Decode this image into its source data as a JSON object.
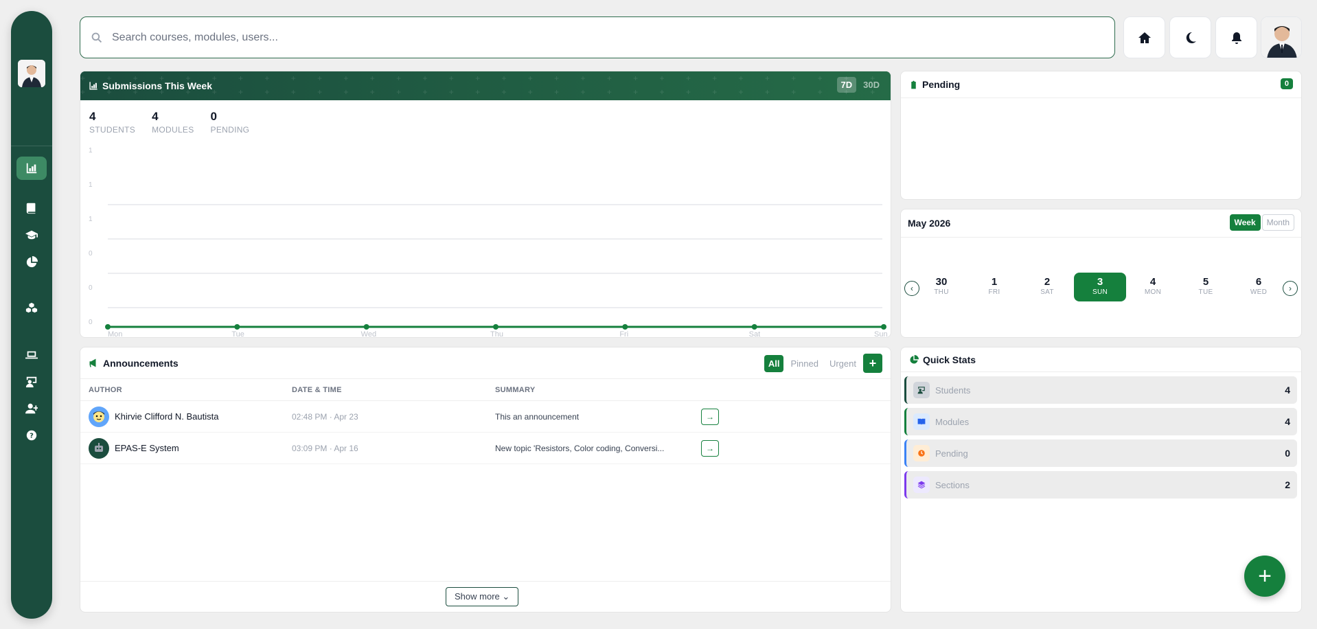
{
  "search": {
    "placeholder": "Search courses, modules, users..."
  },
  "topbar": {
    "icons": [
      "home-icon",
      "moon-icon",
      "bell-icon",
      "user-avatar"
    ]
  },
  "sidebar": {
    "items": [
      "chart-icon",
      "book-icon",
      "graduation-cap-icon",
      "pie-chart-icon",
      "cubes-icon",
      "laptop-icon",
      "teacher-icon",
      "user-plus-icon",
      "help-icon"
    ],
    "active_index": 0
  },
  "submissions": {
    "title": "Submissions This Week",
    "ranges": [
      "7D",
      "30D"
    ],
    "stats": [
      {
        "value": "4",
        "label": "STUDENTS"
      },
      {
        "value": "4",
        "label": "MODULES"
      },
      {
        "value": "0",
        "label": "PENDING"
      }
    ]
  },
  "chart_data": {
    "type": "line",
    "categories": [
      "Mon",
      "Tue",
      "Wed",
      "Thu",
      "Fri",
      "Sat",
      "Sun"
    ],
    "series": [
      {
        "values": [
          0,
          0,
          0,
          0,
          0,
          0,
          0
        ]
      }
    ],
    "y_ticks": [
      "1",
      "1",
      "1",
      "0",
      "0",
      "0"
    ],
    "ylim": [
      0,
      1
    ],
    "grid": true,
    "color": "#15803d"
  },
  "pending": {
    "title": "Pending",
    "count": "0"
  },
  "calendar": {
    "title": "May 2026",
    "views": [
      "Week",
      "Month"
    ],
    "days": [
      {
        "d": "30",
        "w": "THU"
      },
      {
        "d": "1",
        "w": "FRI"
      },
      {
        "d": "2",
        "w": "SAT"
      },
      {
        "d": "3",
        "w": "SUN"
      },
      {
        "d": "4",
        "w": "MON"
      },
      {
        "d": "5",
        "w": "TUE"
      },
      {
        "d": "6",
        "w": "WED"
      }
    ],
    "selected_index": 3,
    "prev": "‹",
    "next": "›"
  },
  "announcements": {
    "title": "Announcements",
    "filters": [
      "All",
      "Pinned",
      "Urgent"
    ],
    "add_label": "+",
    "columns": [
      "AUTHOR",
      "DATE & TIME",
      "SUMMARY"
    ],
    "rows": [
      {
        "author": "Khirvie Clifford N. Bautista",
        "datetime": "02:48 PM · Apr 23",
        "summary": "This an announcement"
      },
      {
        "author": "EPAS-E System",
        "datetime": "03:09 PM · Apr 16",
        "summary": "New topic 'Resistors, Color coding, Conversi..."
      }
    ],
    "open_label": "→",
    "show_more": "Show more ⌄"
  },
  "quick_stats": {
    "title": "Quick Stats",
    "items": [
      {
        "label": "Students",
        "value": "4",
        "color": "#1b4d3e"
      },
      {
        "label": "Modules",
        "value": "4",
        "color": "#15803d"
      },
      {
        "label": "Pending",
        "value": "0",
        "color": "#3b82f6"
      },
      {
        "label": "Sections",
        "value": "2",
        "color": "#7c3aed"
      }
    ]
  },
  "fab_label": "+"
}
